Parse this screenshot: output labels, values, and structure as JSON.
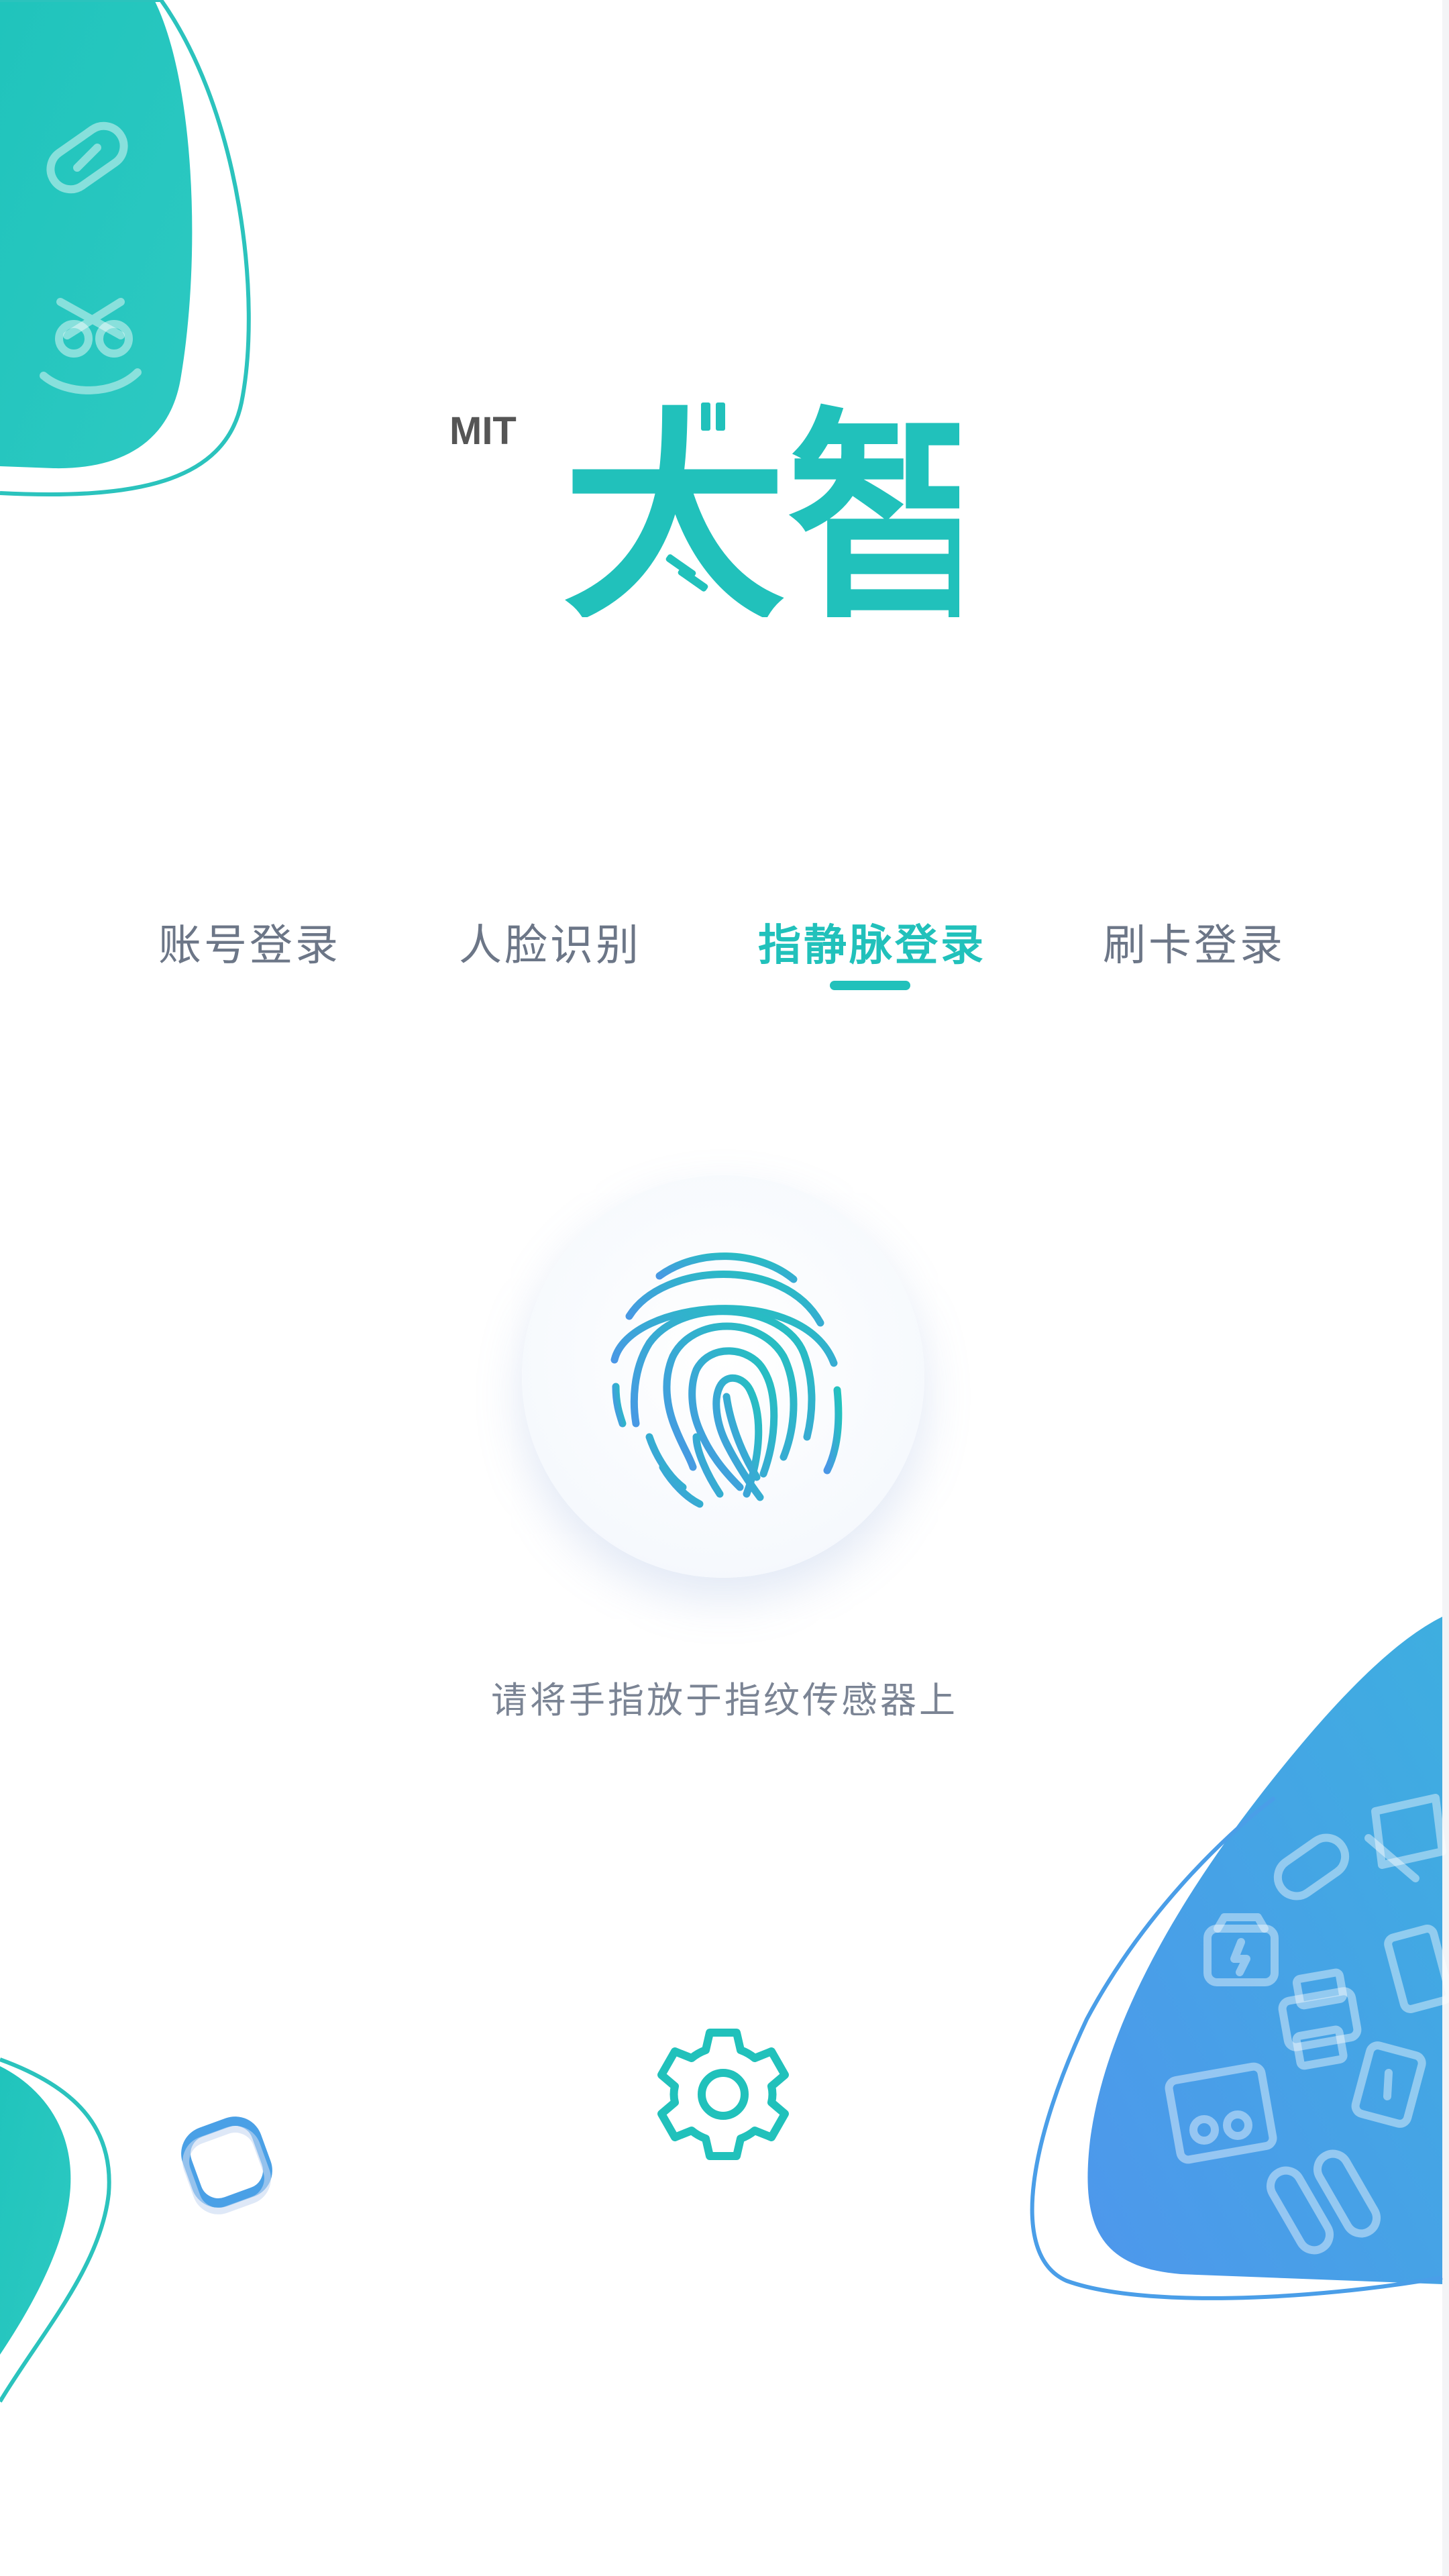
{
  "brand": {
    "logo_text": "MIT大智",
    "logo_prefix": "MIT",
    "logo_mark": "大智",
    "color": "#21c1bb"
  },
  "tabs": [
    {
      "label": "账号登录",
      "active": false
    },
    {
      "label": "人脸识别",
      "active": false
    },
    {
      "label": "指静脉登录",
      "active": true
    },
    {
      "label": "刷卡登录",
      "active": false
    }
  ],
  "scanner": {
    "icon": "fingerprint-icon",
    "hint": "请将手指放于指纹传感器上"
  },
  "settings": {
    "icon": "gear-icon"
  },
  "colors": {
    "accent": "#21c1bb",
    "blue": "#4a9ee8",
    "text_gray": "#6c7687"
  }
}
